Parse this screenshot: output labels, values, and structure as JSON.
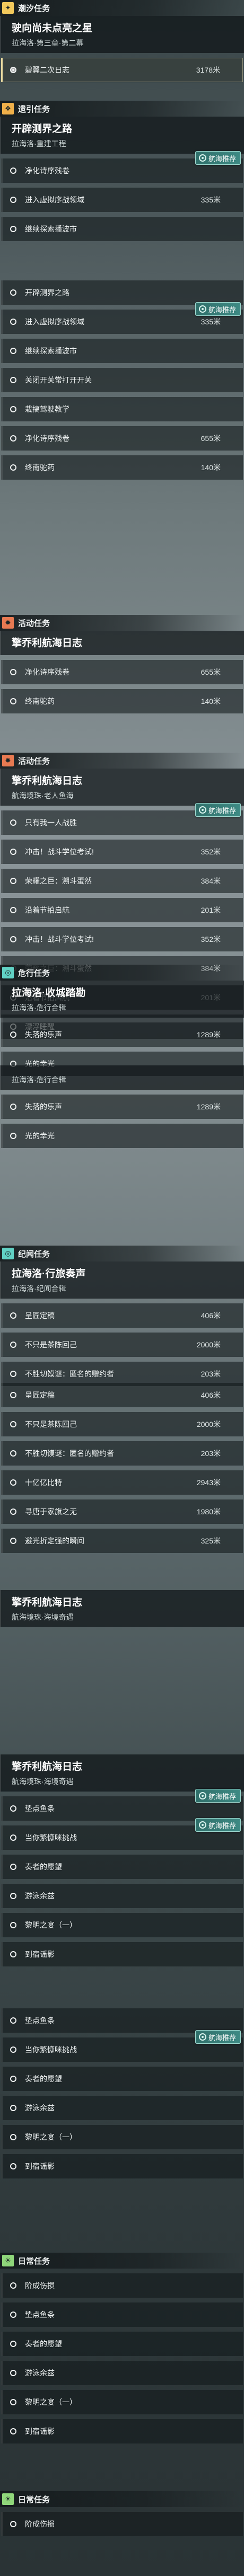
{
  "colors": {
    "main": "#f2c95c",
    "side": "#f0b04a",
    "activity": "#e87a52",
    "world": "#61d1c4",
    "invite": "#7fc2f2",
    "daily": "#8fd67a"
  },
  "badge_text": "航海推荐",
  "sections": [
    {
      "category": "潮汐任务",
      "icon": "main",
      "quest": {
        "title": "驶向尚未点亮之星",
        "subtitle": "拉海洛·第三章·第二幕"
      },
      "items": [
        {
          "label": "碧翼二次日志",
          "dist": "3178米",
          "active": true
        }
      ]
    },
    {
      "category": "遗引任务",
      "icon": "side",
      "quest": {
        "title": "开辟测界之路",
        "subtitle": "拉海洛·重建工程"
      },
      "items": [
        {
          "label": "净化诗序残卷",
          "dist": "",
          "badge": true
        },
        {
          "label": "进入虚拟序战领域",
          "dist": "335米"
        },
        {
          "label": "继续探索播波市",
          "dist": ""
        }
      ]
    },
    {
      "category": "",
      "icon": "",
      "quest": null,
      "items": [
        {
          "label": "开辟测界之路",
          "dist": ""
        },
        {
          "label": "进入虚拟序战领域",
          "dist": "335米",
          "badge": true
        },
        {
          "label": "继续探索播波市",
          "dist": ""
        },
        {
          "label": "关闭开关常打开开关",
          "dist": ""
        },
        {
          "label": "栽搞驾驶教学",
          "dist": ""
        },
        {
          "label": "净化诗序残卷",
          "dist": "655米"
        },
        {
          "label": "终南驼药",
          "dist": "140米"
        }
      ]
    },
    {
      "category": "活动任务",
      "icon": "activity",
      "quest": {
        "title": "擎乔利航海日志",
        "subtitle": ""
      },
      "items": [
        {
          "label": "净化诗序残卷",
          "dist": "655米"
        },
        {
          "label": "终南驼药",
          "dist": "140米"
        }
      ]
    },
    {
      "category": "活动任务",
      "icon": "activity",
      "quest": {
        "title": "擎乔利航海日志",
        "subtitle": "航海境珠·老人鱼海"
      },
      "items": [
        {
          "label": "只有我一人战胜",
          "dist": "",
          "badge": true
        },
        {
          "label": "冲击！战斗学位考试!",
          "dist": "352米"
        },
        {
          "label": "荣耀之巨：溯斗蛋然",
          "dist": "384米"
        },
        {
          "label": "沿着节拍启航",
          "dist": "201米"
        },
        {
          "label": "冲击！战斗学位考试!",
          "dist": "352米"
        },
        {
          "label": "荣耀之巨：溯斗蛋然",
          "dist": "384米"
        },
        {
          "label": "沿着节拍启航",
          "dist": "201米"
        },
        {
          "label": "漂浮睡醒",
          "dist": ""
        }
      ]
    },
    {
      "category": "危行任务",
      "icon": "world",
      "quest": {
        "title": "拉海洛·收城踏勘",
        "subtitle": "拉海洛·危行合辑"
      },
      "items": [
        {
          "label": "失落的乐声",
          "dist": "1289米"
        },
        {
          "label": "光的幸光",
          "dist": ""
        }
      ]
    },
    {
      "category": "",
      "icon": "",
      "quest": {
        "title": "",
        "subtitle": "拉海洛·危行合辑"
      },
      "items": [
        {
          "label": "失落的乐声",
          "dist": "1289米"
        },
        {
          "label": "光的幸光",
          "dist": ""
        }
      ]
    },
    {
      "category": "纪闻任务",
      "icon": "world",
      "quest": {
        "title": "拉海洛·行旅奏声",
        "subtitle": "拉海洛·纪闻合辑"
      },
      "items": [
        {
          "label": "呈匠定稿",
          "dist": "406米"
        },
        {
          "label": "不只是茶陈回己",
          "dist": "2000米"
        },
        {
          "label": "不胜切馍谜：匿名的赠约者",
          "dist": "203米"
        }
      ]
    },
    {
      "category": "",
      "icon": "",
      "quest": null,
      "items": [
        {
          "label": "呈匠定稿",
          "dist": "406米"
        },
        {
          "label": "不只是茶陈回己",
          "dist": "2000米"
        },
        {
          "label": "不胜切馍谜：匿名的赠约者",
          "dist": "203米"
        },
        {
          "label": "十亿亿比特",
          "dist": "2943米"
        },
        {
          "label": "寻唐于家旗之无",
          "dist": "1980米"
        },
        {
          "label": "避光折定强的瞬间",
          "dist": "325米"
        }
      ]
    },
    {
      "category": "",
      "icon": "",
      "quest": {
        "title": "擎乔利航海日志",
        "subtitle": "航海境珠·海境奇遇"
      },
      "items": []
    },
    {
      "category": "",
      "icon": "",
      "quest": {
        "title": "擎乔利航海日志",
        "subtitle": "航海境珠·海境奇遇"
      },
      "items": [
        {
          "label": "垫点鱼条",
          "dist": "",
          "badge": true
        },
        {
          "label": "当你繁慷咪挑战",
          "dist": "",
          "badge": true
        },
        {
          "label": "奏者的愿望",
          "dist": ""
        },
        {
          "label": "游泳余兹",
          "dist": ""
        },
        {
          "label": "黎明之宴（一）",
          "dist": ""
        },
        {
          "label": "到宿谣影",
          "dist": ""
        }
      ]
    },
    {
      "category": "",
      "icon": "",
      "quest": null,
      "items": [
        {
          "label": "垫点鱼条",
          "dist": ""
        },
        {
          "label": "当你繁慷咪挑战",
          "dist": "",
          "badge": true
        },
        {
          "label": "奏者的愿望",
          "dist": ""
        },
        {
          "label": "游泳余兹",
          "dist": ""
        },
        {
          "label": "黎明之宴（一）",
          "dist": ""
        },
        {
          "label": "到宿谣影",
          "dist": ""
        }
      ]
    },
    {
      "category": "日常任务",
      "icon": "daily",
      "quest": null,
      "items": [
        {
          "label": "阶成伤损",
          "dist": ""
        },
        {
          "label": "垫点鱼条",
          "dist": ""
        },
        {
          "label": "奏者的愿望",
          "dist": ""
        },
        {
          "label": "游泳余兹",
          "dist": ""
        },
        {
          "label": "黎明之宴（一）",
          "dist": ""
        },
        {
          "label": "到宿谣影",
          "dist": ""
        }
      ]
    },
    {
      "category": "日常任务",
      "icon": "daily",
      "quest": null,
      "items": [
        {
          "label": "阶成伤损",
          "dist": ""
        }
      ]
    }
  ]
}
